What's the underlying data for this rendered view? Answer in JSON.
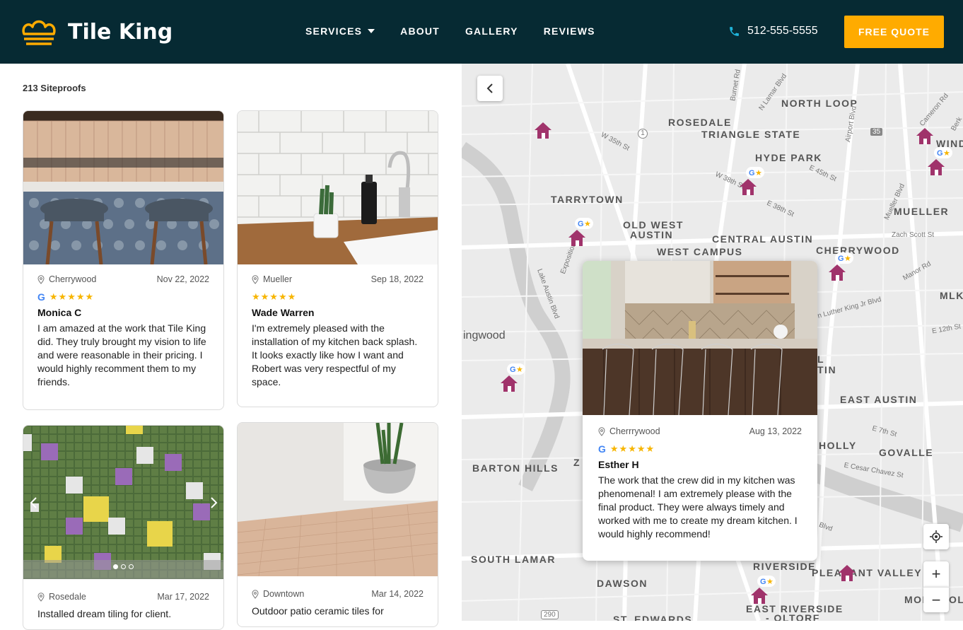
{
  "header": {
    "brand": "Tile King",
    "nav": [
      {
        "label": "SERVICES"
      },
      {
        "label": "ABOUT"
      },
      {
        "label": "GALLERY"
      },
      {
        "label": "REVIEWS"
      }
    ],
    "phone": "512-555-5555",
    "cta": "FREE QUOTE"
  },
  "list": {
    "count": "213 Siteproofs",
    "cards": [
      {
        "location": "Cherrywood",
        "date": "Nov 22, 2022",
        "google": "G",
        "stars": "★★★★★",
        "name": "Monica C",
        "text": "I am amazed at the work that Tile King did. They truly brought my vision to life and were reasonable in their pricing. I would highly recomment them to my friends."
      },
      {
        "location": "Mueller",
        "date": "Sep 18, 2022",
        "stars": "★★★★★",
        "name": "Wade Warren",
        "text": "I'm extremely pleased with the installation of my kitchen back splash. It looks exactly like how I want and Robert was very respectful of my space."
      },
      {
        "location": "Rosedale",
        "date": "Mar 17, 2022",
        "text": "Installed dream tiling for client."
      },
      {
        "location": "Downtown",
        "date": "Mar 14, 2022",
        "text": "Outdoor patio ceramic tiles for"
      }
    ]
  },
  "map": {
    "labels": [
      "NORTH LOOP",
      "ROSEDALE",
      "TRIANGLE STATE",
      "HYDE PARK",
      "TARRYTOWN",
      "OLD WEST",
      "AUSTIN",
      "CENTRAL AUSTIN",
      "WEST CAMPUS",
      "CHERRYWOOD",
      "MUELLER",
      "MLK",
      "EAST AUSTIN",
      "HOLLY",
      "GOVALLE",
      "BARTON HILLS",
      "SOUTH LAMAR",
      "DAWSON",
      "RIVERSIDE",
      "PLEASANT VALLEY",
      "EAST RIVERSIDE",
      "- OLTORF",
      "ST. EDWARDS",
      "MON",
      "OLI",
      "WINDS",
      "ingwood",
      "Z",
      "L",
      "TIN"
    ],
    "streets": [
      "W 35th St",
      "E 45th St",
      "W 38th St",
      "E 38th St",
      "Airport Blvd",
      "Mueller Blvd",
      "Zach Scott St",
      "Manor Rd",
      "n Luther King Jr Blvd",
      "E 12th St",
      "E 7th St",
      "E Cesar Chavez St",
      "Lake Austin Blvd",
      "Exposition",
      "Burnet Rd",
      "N Lamar Blvd",
      "Cameron Rd",
      "Berk",
      "Blvd",
      "1",
      "35",
      "290"
    ],
    "popup": {
      "location": "Cherrrywood",
      "date": "Aug 13, 2022",
      "google": "G",
      "stars": "★★★★★",
      "name": "Esther H",
      "text": "The work that the crew did in my kitchen was phenomenal! I am extremely please with the final product. They were always timely and worked with me to create my dream kitchen. I would highly recommend!"
    },
    "zoom_in": "+",
    "zoom_out": "−"
  },
  "colors": {
    "header_bg": "#062a33",
    "accent": "#ffab00",
    "pin": "#a0336b"
  }
}
